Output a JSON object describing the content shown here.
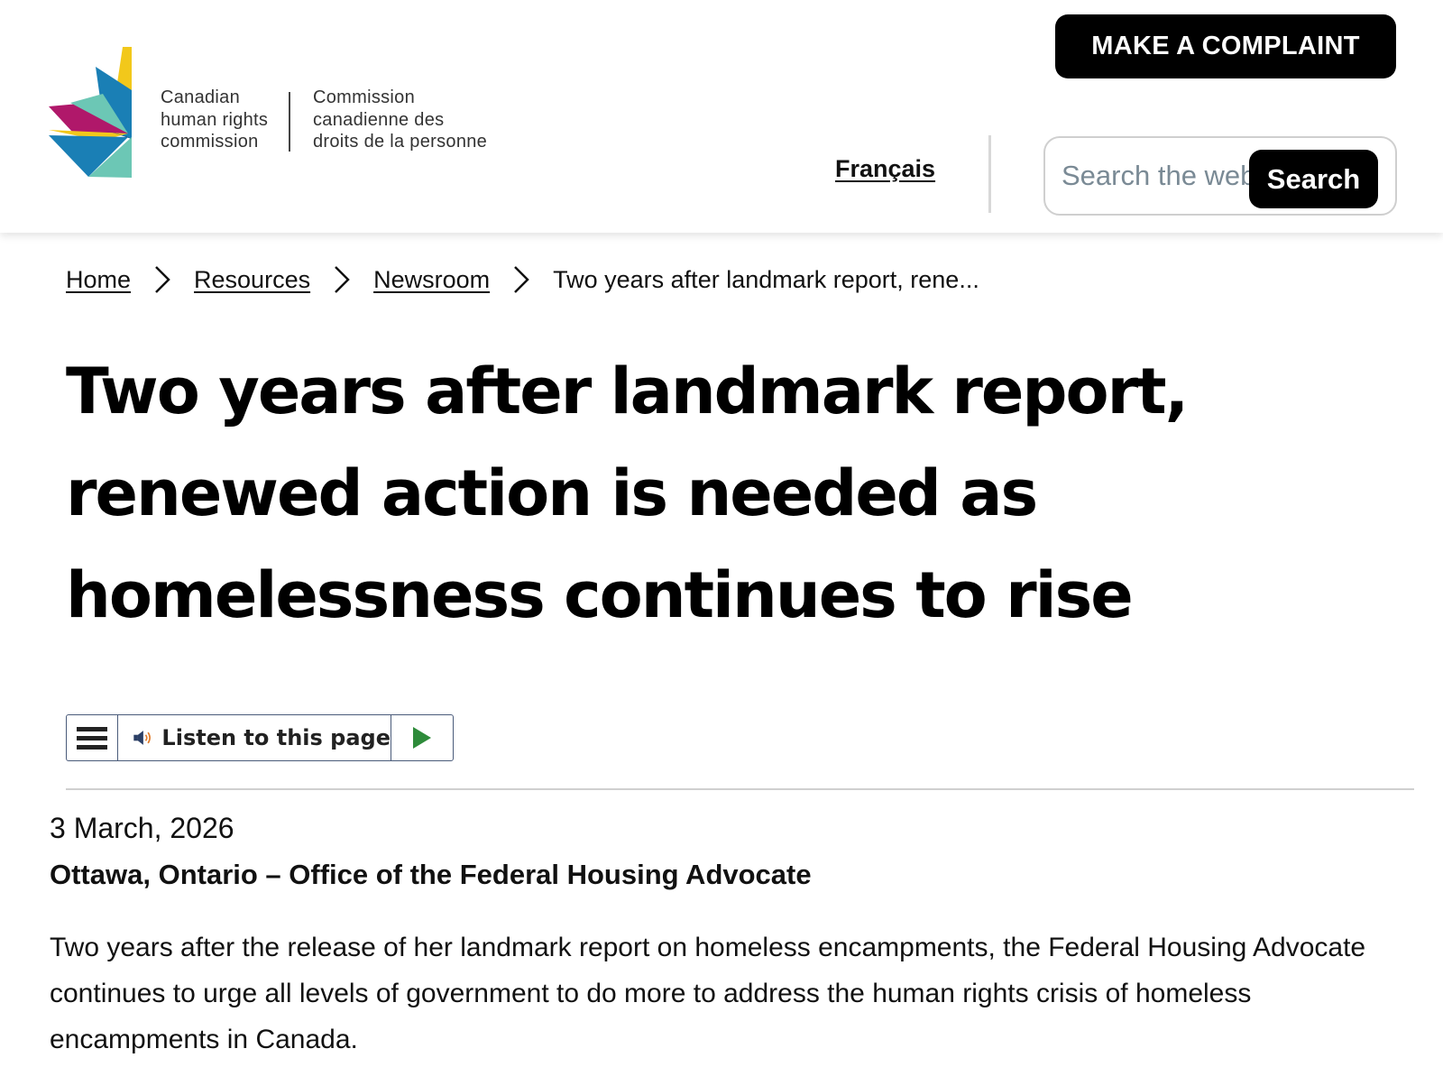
{
  "header": {
    "org_name_en": [
      "Canadian",
      "human rights",
      "commission"
    ],
    "org_name_fr": [
      "Commission",
      "canadienne des",
      "droits de la personne"
    ],
    "complaint_button": "MAKE A COMPLAINT",
    "language_link": "Français",
    "search_placeholder": "Search the website",
    "search_button": "Search"
  },
  "breadcrumb": {
    "home": "Home",
    "resources": "Resources",
    "newsroom": "Newsroom",
    "current": "Two years after landmark report, rene..."
  },
  "article": {
    "title": "Two years after landmark report, renewed action is needed as homelessness continues to rise",
    "listen_label": "Listen to this page",
    "date": "3 March, 2026",
    "dateline": "Ottawa, Ontario – Office of the Federal Housing Advocate",
    "paragraph": "Two years after the release of her landmark report on homeless encampments, the Federal Housing Advocate continues to urge all levels of government to do more to address the human rights crisis of homeless encampments in Canada."
  },
  "icons": {
    "logo": "chrhc-logo",
    "chevron": "chevron-right-icon",
    "menu": "hamburger-icon",
    "speaker": "speaker-icon",
    "play": "play-icon"
  },
  "colors": {
    "button_bg": "#000000",
    "play_green": "#2e8b3a",
    "logo_yellow": "#f2c81b",
    "logo_blue": "#1a7fb5",
    "logo_magenta": "#b0186a",
    "logo_teal": "#6cc7b5"
  }
}
